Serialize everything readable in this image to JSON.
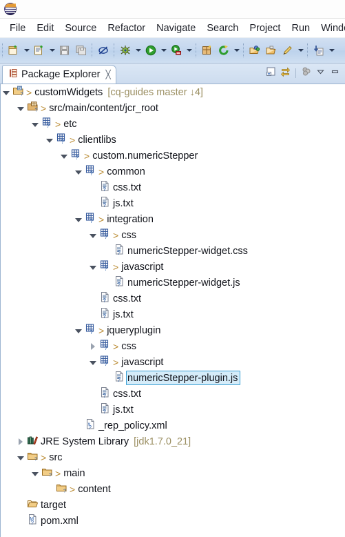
{
  "window": {
    "logo_icon": "eclipse-logo-icon"
  },
  "menubar": {
    "items": [
      {
        "label": "File"
      },
      {
        "label": "Edit"
      },
      {
        "label": "Source"
      },
      {
        "label": "Refactor"
      },
      {
        "label": "Navigate"
      },
      {
        "label": "Search"
      },
      {
        "label": "Project"
      },
      {
        "label": "Run"
      },
      {
        "label": "Window"
      }
    ]
  },
  "toolbar": {
    "buttons": [
      {
        "name": "new-wizard-button",
        "icon": "new-file-icon",
        "dropdown": true
      },
      {
        "name": "new-java-class-button",
        "icon": "new-java-class-icon",
        "dropdown": true
      },
      {
        "name": "save-button",
        "icon": "save-icon",
        "dropdown": false
      },
      {
        "name": "save-all-button",
        "icon": "save-all-icon",
        "dropdown": false
      },
      {
        "name": "skip-breakpoints-button",
        "icon": "skip-all-breakpoints-icon",
        "dropdown": false
      },
      {
        "name": "debug-button",
        "icon": "debug-bug-icon",
        "dropdown": true
      },
      {
        "name": "run-button",
        "icon": "run-play-icon",
        "dropdown": true
      },
      {
        "name": "run-external-tools-button",
        "icon": "external-tools-icon",
        "dropdown": true
      },
      {
        "name": "new-package-button",
        "icon": "new-package-icon",
        "dropdown": false
      },
      {
        "name": "refresh-button",
        "icon": "refresh-icon",
        "dropdown": true
      },
      {
        "name": "open-type-button",
        "icon": "open-type-icon",
        "dropdown": false
      },
      {
        "name": "open-resource-button",
        "icon": "open-folder-icon",
        "dropdown": false
      },
      {
        "name": "annotation-button",
        "icon": "pencil-annotation-icon",
        "dropdown": true
      },
      {
        "name": "previous-annotation-button",
        "icon": "next-annotation-icon",
        "dropdown": true
      }
    ]
  },
  "view": {
    "tab": {
      "icon": "package-explorer-icon",
      "label": "Package Explorer",
      "close_glyph": "╳"
    },
    "tools": [
      {
        "name": "collapse-all-button",
        "icon": "collapse-all-icon"
      },
      {
        "name": "link-with-editor-button",
        "icon": "link-with-editor-icon"
      },
      {
        "name": "focus-on-active-task-button",
        "icon": "focus-active-task-icon"
      },
      {
        "name": "view-menu-button",
        "icon": "chevron-down-icon"
      },
      {
        "name": "minimize-view-button",
        "icon": "minimize-icon"
      }
    ]
  },
  "tree": {
    "rows": [
      {
        "depth": 0,
        "twisty": "open",
        "icon": "project-folder-icon",
        "gt": true,
        "name": "customWidgets",
        "suffix": "[cq-guides master ↓4]",
        "selected": false
      },
      {
        "depth": 1,
        "twisty": "open",
        "icon": "source-package-icon",
        "gt": true,
        "name": "src/main/content/jcr_root",
        "suffix": "",
        "selected": false
      },
      {
        "depth": 2,
        "twisty": "open",
        "icon": "jcr-node-icon",
        "gt": true,
        "name": "etc",
        "suffix": "",
        "selected": false
      },
      {
        "depth": 3,
        "twisty": "open",
        "icon": "jcr-node-icon",
        "gt": true,
        "name": "clientlibs",
        "suffix": "",
        "selected": false
      },
      {
        "depth": 4,
        "twisty": "open",
        "icon": "jcr-node-icon",
        "gt": true,
        "name": "custom.numericStepper",
        "suffix": "",
        "selected": false
      },
      {
        "depth": 5,
        "twisty": "open",
        "icon": "jcr-node-icon",
        "gt": true,
        "name": "common",
        "suffix": "",
        "selected": false
      },
      {
        "depth": 6,
        "twisty": "none",
        "icon": "text-file-icon",
        "gt": false,
        "name": "css.txt",
        "suffix": "",
        "selected": false
      },
      {
        "depth": 6,
        "twisty": "none",
        "icon": "text-file-icon",
        "gt": false,
        "name": "js.txt",
        "suffix": "",
        "selected": false
      },
      {
        "depth": 5,
        "twisty": "open",
        "icon": "jcr-node-icon",
        "gt": true,
        "name": "integration",
        "suffix": "",
        "selected": false
      },
      {
        "depth": 6,
        "twisty": "open",
        "icon": "jcr-node-icon",
        "gt": true,
        "name": "css",
        "suffix": "",
        "selected": false
      },
      {
        "depth": 7,
        "twisty": "none",
        "icon": "text-file-icon",
        "gt": false,
        "name": "numericStepper-widget.css",
        "suffix": "",
        "selected": false
      },
      {
        "depth": 6,
        "twisty": "open",
        "icon": "jcr-node-icon",
        "gt": true,
        "name": "javascript",
        "suffix": "",
        "selected": false
      },
      {
        "depth": 7,
        "twisty": "none",
        "icon": "text-file-icon",
        "gt": false,
        "name": "numericStepper-widget.js",
        "suffix": "",
        "selected": false
      },
      {
        "depth": 6,
        "twisty": "none",
        "icon": "text-file-icon",
        "gt": false,
        "name": "css.txt",
        "suffix": "",
        "selected": false
      },
      {
        "depth": 6,
        "twisty": "none",
        "icon": "text-file-icon",
        "gt": false,
        "name": "js.txt",
        "suffix": "",
        "selected": false
      },
      {
        "depth": 5,
        "twisty": "open",
        "icon": "jcr-node-icon",
        "gt": true,
        "name": "jqueryplugin",
        "suffix": "",
        "selected": false
      },
      {
        "depth": 6,
        "twisty": "closed",
        "icon": "jcr-node-icon",
        "gt": true,
        "name": "css",
        "suffix": "",
        "selected": false
      },
      {
        "depth": 6,
        "twisty": "open",
        "icon": "jcr-node-icon",
        "gt": true,
        "name": "javascript",
        "suffix": "",
        "selected": false
      },
      {
        "depth": 7,
        "twisty": "none",
        "icon": "text-file-icon",
        "gt": false,
        "name": "numericStepper-plugin.js",
        "suffix": "",
        "selected": true
      },
      {
        "depth": 6,
        "twisty": "none",
        "icon": "text-file-icon",
        "gt": false,
        "name": "css.txt",
        "suffix": "",
        "selected": false
      },
      {
        "depth": 6,
        "twisty": "none",
        "icon": "text-file-icon",
        "gt": false,
        "name": "js.txt",
        "suffix": "",
        "selected": false
      },
      {
        "depth": 5,
        "twisty": "none",
        "icon": "xml-file-icon",
        "gt": false,
        "name": "_rep_policy.xml",
        "suffix": "",
        "selected": false
      },
      {
        "depth": 1,
        "twisty": "closed",
        "icon": "jre-library-icon",
        "gt": false,
        "name": "JRE System Library",
        "suffix": "[jdk1.7.0_21]",
        "selected": false
      },
      {
        "depth": 1,
        "twisty": "open",
        "icon": "plain-folder-icon",
        "gt": true,
        "name": "src",
        "suffix": "",
        "selected": false
      },
      {
        "depth": 2,
        "twisty": "open",
        "icon": "plain-folder-icon",
        "gt": true,
        "name": "main",
        "suffix": "",
        "selected": false
      },
      {
        "depth": 3,
        "twisty": "none",
        "icon": "plain-folder-icon",
        "gt": true,
        "name": "content",
        "suffix": "",
        "selected": false
      },
      {
        "depth": 1,
        "twisty": "none",
        "icon": "open-folder-icon",
        "gt": false,
        "name": "target",
        "suffix": "",
        "selected": false
      },
      {
        "depth": 1,
        "twisty": "none",
        "icon": "maven-pom-icon",
        "gt": false,
        "name": "pom.xml",
        "suffix": "",
        "selected": false
      }
    ]
  },
  "colors": {
    "selection_fill": "#d5ecf9",
    "selection_border": "#3a9fd4",
    "toolbar_bg": "#c3d6ee",
    "view_bg": "#d6e3f3",
    "suffix_text": "#9b8f62",
    "gt_marker": "#b9892f"
  }
}
